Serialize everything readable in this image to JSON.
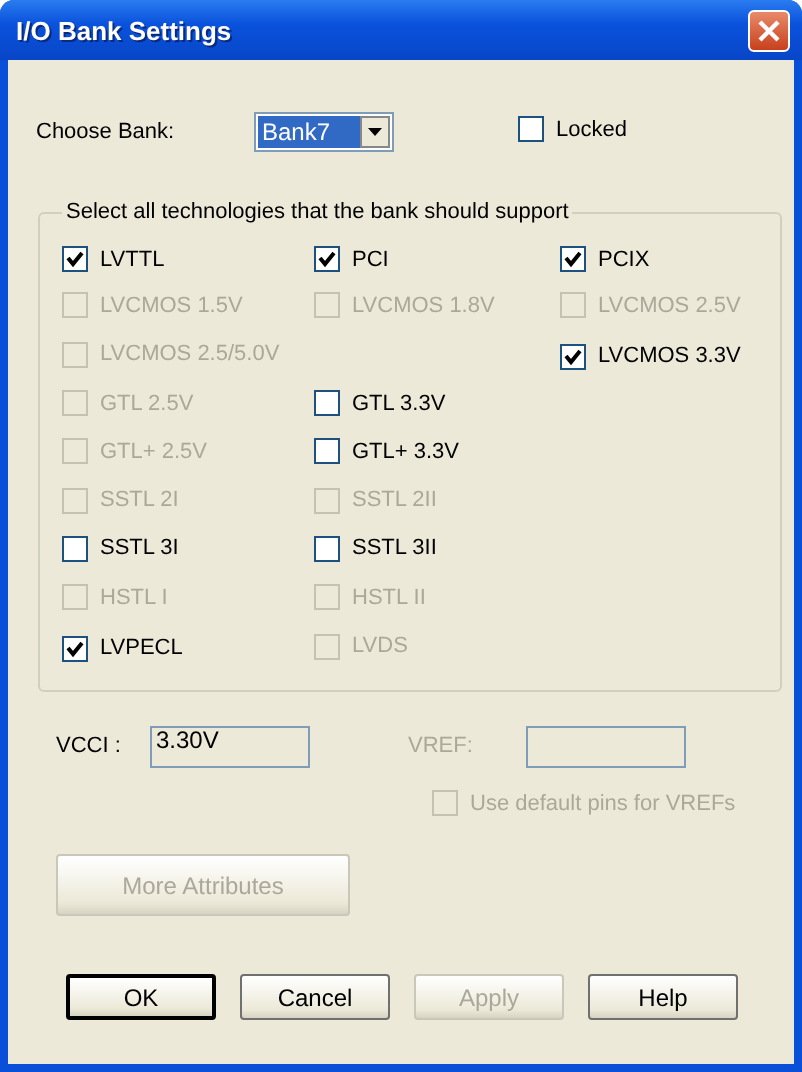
{
  "window": {
    "title": "I/O Bank Settings"
  },
  "bank": {
    "label": "Choose Bank:",
    "value": "Bank7"
  },
  "locked": {
    "label": "Locked",
    "checked": false,
    "disabled": false
  },
  "group": {
    "title": "Select all technologies that the bank should support",
    "rows": [
      {
        "left": {
          "label": "LVTTL",
          "checked": true,
          "disabled": false
        },
        "middle": {
          "label": "PCI",
          "checked": true,
          "disabled": false
        },
        "right": {
          "label": "PCIX",
          "checked": true,
          "disabled": false
        }
      },
      {
        "left": {
          "label": "LVCMOS 1.5V",
          "checked": false,
          "disabled": true
        },
        "middle": {
          "label": "LVCMOS 1.8V",
          "checked": false,
          "disabled": true
        },
        "right": {
          "label": "LVCMOS 2.5V",
          "checked": false,
          "disabled": true
        }
      },
      {
        "left": {
          "label": "LVCMOS 2.5/5.0V",
          "checked": false,
          "disabled": true
        },
        "right": {
          "label": "LVCMOS 3.3V",
          "checked": true,
          "disabled": false
        }
      },
      {
        "left": {
          "label": "GTL 2.5V",
          "checked": false,
          "disabled": true
        },
        "middle": {
          "label": "GTL 3.3V",
          "checked": false,
          "disabled": false
        }
      },
      {
        "left": {
          "label": "GTL+ 2.5V",
          "checked": false,
          "disabled": true
        },
        "middle": {
          "label": "GTL+ 3.3V",
          "checked": false,
          "disabled": false
        }
      },
      {
        "left": {
          "label": "SSTL 2I",
          "checked": false,
          "disabled": true
        },
        "middle": {
          "label": "SSTL 2II",
          "checked": false,
          "disabled": true
        }
      },
      {
        "left": {
          "label": "SSTL 3I",
          "checked": false,
          "disabled": false
        },
        "middle": {
          "label": "SSTL 3II",
          "checked": false,
          "disabled": false
        }
      },
      {
        "left": {
          "label": "HSTL I",
          "checked": false,
          "disabled": true
        },
        "middle": {
          "label": "HSTL II",
          "checked": false,
          "disabled": true
        }
      },
      {
        "left": {
          "label": "LVPECL",
          "checked": true,
          "disabled": false
        },
        "middle": {
          "label": "LVDS",
          "checked": false,
          "disabled": true
        }
      }
    ]
  },
  "vcci": {
    "label": "VCCI :",
    "value": "3.30V"
  },
  "vref": {
    "label": "VREF:",
    "disabled": true
  },
  "default_pins": {
    "label": "Use default pins for VREFs",
    "checked": false,
    "disabled": true
  },
  "more_button": {
    "label": "More Attributes",
    "disabled": true
  },
  "buttons": [
    {
      "label": "OK",
      "disabled": false,
      "default": true
    },
    {
      "label": "Cancel",
      "disabled": false,
      "default": false
    },
    {
      "label": "Apply",
      "disabled": true,
      "default": false
    },
    {
      "label": "Help",
      "disabled": false,
      "default": false
    }
  ]
}
